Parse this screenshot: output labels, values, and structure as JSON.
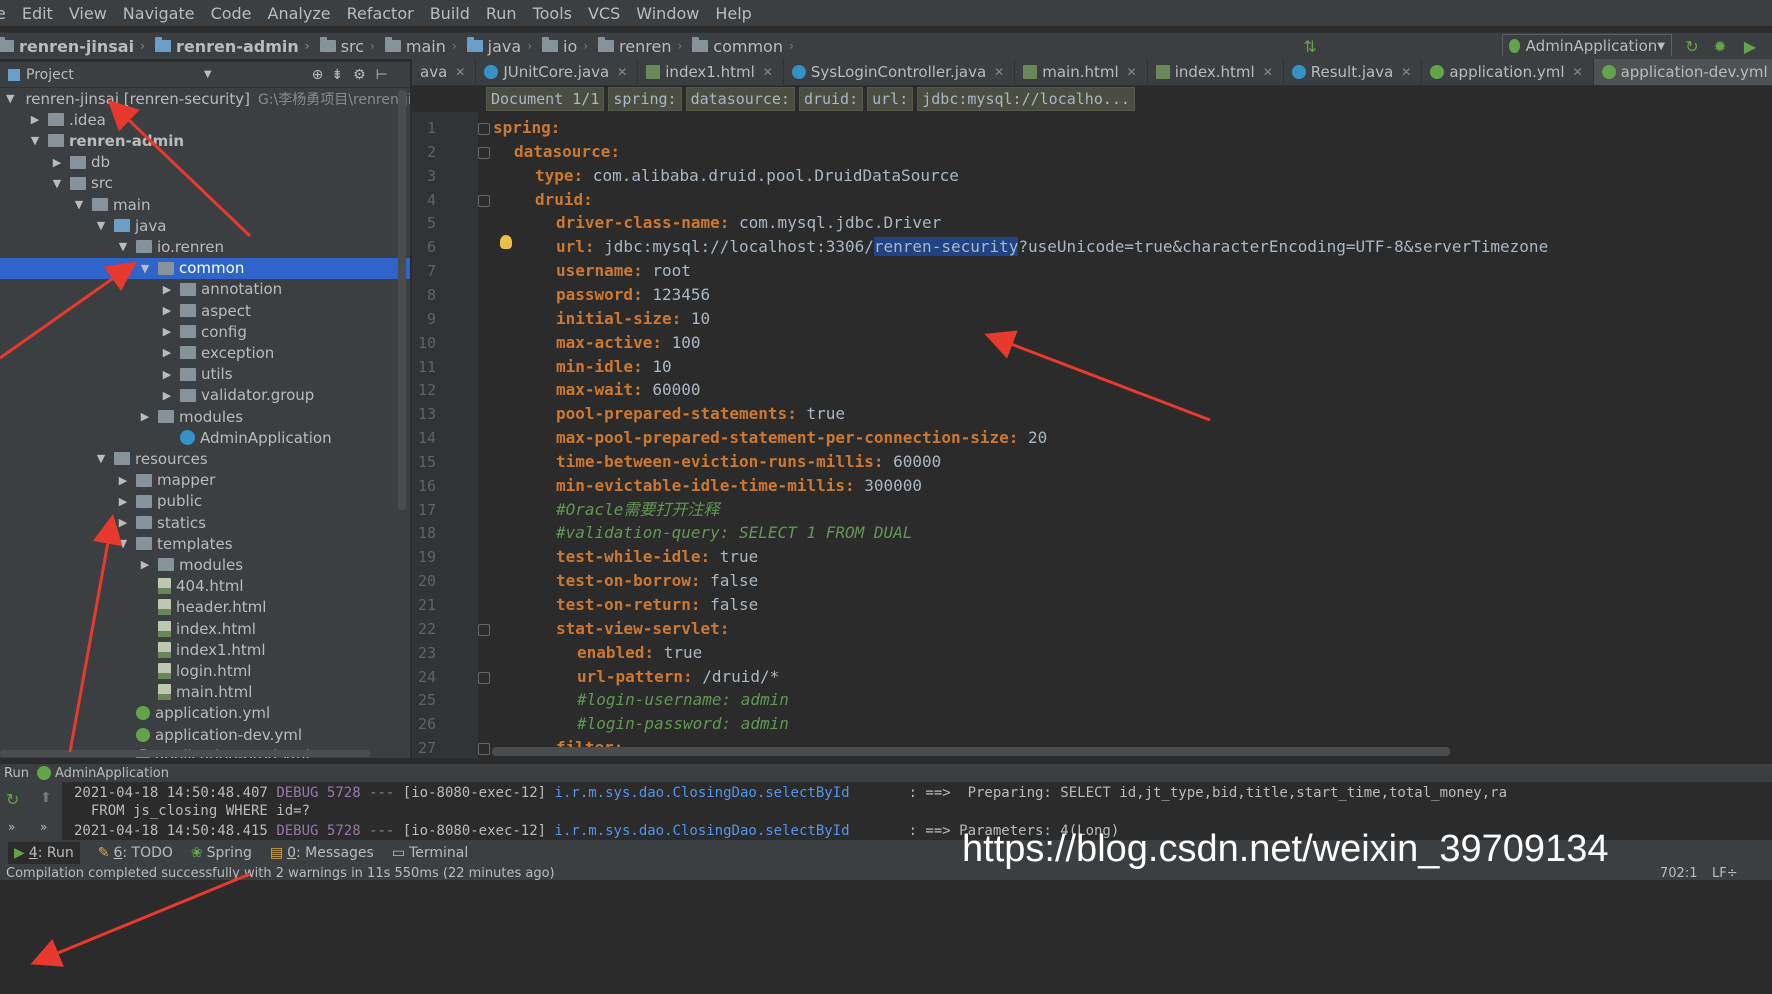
{
  "menu": [
    "e",
    "Edit",
    "View",
    "Navigate",
    "Code",
    "Analyze",
    "Refactor",
    "Build",
    "Run",
    "Tools",
    "VCS",
    "Window",
    "Help"
  ],
  "breadcrumbs": [
    {
      "label": "renren-jinsai",
      "bold": true
    },
    {
      "label": "renren-admin",
      "bold": true
    },
    {
      "label": "src"
    },
    {
      "label": "main"
    },
    {
      "label": "java"
    },
    {
      "label": "io"
    },
    {
      "label": "renren"
    },
    {
      "label": "common"
    }
  ],
  "run_config": "AdminApplication",
  "project_panel": {
    "title": "Project"
  },
  "tree": [
    {
      "label": "renren-jinsai [renren-security]",
      "extra": "G:\\李杨勇项目\\renren-jinsai",
      "depth": 0,
      "arrow": "▼",
      "icon": "folder",
      "bold": false
    },
    {
      "label": ".idea",
      "depth": 1,
      "arrow": "▶",
      "icon": "folder"
    },
    {
      "label": "renren-admin",
      "depth": 1,
      "arrow": "▼",
      "icon": "folder",
      "bold": true
    },
    {
      "label": "db",
      "depth": 2,
      "arrow": "▶",
      "icon": "folder"
    },
    {
      "label": "src",
      "depth": 2,
      "arrow": "▼",
      "icon": "folder"
    },
    {
      "label": "main",
      "depth": 3,
      "arrow": "▼",
      "icon": "folder"
    },
    {
      "label": "java",
      "depth": 4,
      "arrow": "▼",
      "icon": "folder-blue"
    },
    {
      "label": "io.renren",
      "depth": 5,
      "arrow": "▼",
      "icon": "folder"
    },
    {
      "label": "common",
      "depth": 6,
      "arrow": "▼",
      "icon": "folder",
      "selected": true
    },
    {
      "label": "annotation",
      "depth": 7,
      "arrow": "▶",
      "icon": "folder"
    },
    {
      "label": "aspect",
      "depth": 7,
      "arrow": "▶",
      "icon": "folder"
    },
    {
      "label": "config",
      "depth": 7,
      "arrow": "▶",
      "icon": "folder"
    },
    {
      "label": "exception",
      "depth": 7,
      "arrow": "▶",
      "icon": "folder"
    },
    {
      "label": "utils",
      "depth": 7,
      "arrow": "▶",
      "icon": "folder"
    },
    {
      "label": "validator.group",
      "depth": 7,
      "arrow": "▶",
      "icon": "folder"
    },
    {
      "label": "modules",
      "depth": 6,
      "arrow": "▶",
      "icon": "folder"
    },
    {
      "label": "AdminApplication",
      "depth": 7,
      "arrow": "",
      "icon": "class"
    },
    {
      "label": "resources",
      "depth": 4,
      "arrow": "▼",
      "icon": "folder"
    },
    {
      "label": "mapper",
      "depth": 5,
      "arrow": "▶",
      "icon": "folder"
    },
    {
      "label": "public",
      "depth": 5,
      "arrow": "▶",
      "icon": "folder"
    },
    {
      "label": "statics",
      "depth": 5,
      "arrow": "▶",
      "icon": "folder"
    },
    {
      "label": "templates",
      "depth": 5,
      "arrow": "▼",
      "icon": "folder"
    },
    {
      "label": "modules",
      "depth": 6,
      "arrow": "▶",
      "icon": "folder"
    },
    {
      "label": "404.html",
      "depth": 6,
      "arrow": "",
      "icon": "html"
    },
    {
      "label": "header.html",
      "depth": 6,
      "arrow": "",
      "icon": "html"
    },
    {
      "label": "index.html",
      "depth": 6,
      "arrow": "",
      "icon": "html"
    },
    {
      "label": "index1.html",
      "depth": 6,
      "arrow": "",
      "icon": "html"
    },
    {
      "label": "login.html",
      "depth": 6,
      "arrow": "",
      "icon": "html"
    },
    {
      "label": "main.html",
      "depth": 6,
      "arrow": "",
      "icon": "html"
    },
    {
      "label": "application.yml",
      "depth": 5,
      "arrow": "",
      "icon": "yml"
    },
    {
      "label": "application-dev.yml",
      "depth": 5,
      "arrow": "",
      "icon": "yml"
    },
    {
      "label": "application-prod.yml",
      "depth": 5,
      "arrow": "",
      "icon": "yml"
    }
  ],
  "tabs": [
    {
      "label": "ava",
      "icon": "none"
    },
    {
      "label": "JUnitCore.java",
      "icon": "class"
    },
    {
      "label": "index1.html",
      "icon": "html"
    },
    {
      "label": "SysLoginController.java",
      "icon": "class"
    },
    {
      "label": "main.html",
      "icon": "html"
    },
    {
      "label": "index.html",
      "icon": "html"
    },
    {
      "label": "Result.java",
      "icon": "class"
    },
    {
      "label": "application.yml",
      "icon": "yml"
    },
    {
      "label": "application-dev.yml",
      "icon": "yml",
      "active": true
    }
  ],
  "editor_breadcrumb": [
    "Document 1/1",
    "spring:",
    "datasource:",
    "druid:",
    "url:",
    "jdbc:mysql://localho..."
  ],
  "code_lines": [
    {
      "n": "1",
      "indent": 0,
      "key": "spring:",
      "val": ""
    },
    {
      "n": "2",
      "indent": 2,
      "key": "datasource:",
      "val": ""
    },
    {
      "n": "3",
      "indent": 4,
      "key": "type:",
      "val": " com.alibaba.druid.pool.DruidDataSource"
    },
    {
      "n": "4",
      "indent": 4,
      "key": "druid:",
      "val": ""
    },
    {
      "n": "5",
      "indent": 6,
      "key": "driver-class-name:",
      "val": " com.mysql.jdbc.Driver"
    },
    {
      "n": "6",
      "indent": 6,
      "key": "url:",
      "val": " jdbc:mysql://localhost:3306/",
      "hl": "renren-security",
      "tail": "?useUnicode=true&characterEncoding=UTF-8&serverTimezone"
    },
    {
      "n": "7",
      "indent": 6,
      "key": "username:",
      "val": " root"
    },
    {
      "n": "8",
      "indent": 6,
      "key": "password:",
      "val": " 123456"
    },
    {
      "n": "9",
      "indent": 6,
      "key": "initial-size:",
      "val": " 10"
    },
    {
      "n": "10",
      "indent": 6,
      "key": "max-active:",
      "val": " 100"
    },
    {
      "n": "11",
      "indent": 6,
      "key": "min-idle:",
      "val": " 10"
    },
    {
      "n": "12",
      "indent": 6,
      "key": "max-wait:",
      "val": " 60000"
    },
    {
      "n": "13",
      "indent": 6,
      "key": "pool-prepared-statements:",
      "val": " true"
    },
    {
      "n": "14",
      "indent": 6,
      "key": "max-pool-prepared-statement-per-connection-size:",
      "val": " 20"
    },
    {
      "n": "15",
      "indent": 6,
      "key": "time-between-eviction-runs-millis:",
      "val": " 60000"
    },
    {
      "n": "16",
      "indent": 6,
      "key": "min-evictable-idle-time-millis:",
      "val": " 300000"
    },
    {
      "n": "17",
      "indent": 6,
      "comment": "#Oracle需要打开注释"
    },
    {
      "n": "18",
      "indent": 6,
      "comment": "#validation-query: SELECT 1 FROM DUAL"
    },
    {
      "n": "19",
      "indent": 6,
      "key": "test-while-idle:",
      "val": " true"
    },
    {
      "n": "20",
      "indent": 6,
      "key": "test-on-borrow:",
      "val": " false"
    },
    {
      "n": "21",
      "indent": 6,
      "key": "test-on-return:",
      "val": " false"
    },
    {
      "n": "22",
      "indent": 6,
      "key": "stat-view-servlet:",
      "val": ""
    },
    {
      "n": "23",
      "indent": 8,
      "key": "enabled:",
      "val": " true"
    },
    {
      "n": "24",
      "indent": 8,
      "key": "url-pattern:",
      "val": " /druid/*"
    },
    {
      "n": "25",
      "indent": 8,
      "comment": "#login-username: admin"
    },
    {
      "n": "26",
      "indent": 8,
      "comment": "#login-password: admin"
    },
    {
      "n": "27",
      "indent": 6,
      "key": "filter:",
      "val": ""
    }
  ],
  "run_panel": {
    "label": "Run",
    "config": "AdminApplication",
    "log": [
      {
        "ts": "2021-04-18 14:50:48.407",
        "lvl": "DEBUG",
        "pid": "5728",
        "sep": "---",
        "thread": "[io-8080-exec-12]",
        "logger": "i.r.m.sys.dao.ClosingDao.selectById",
        "msg": ": ==>  Preparing: SELECT id,jt_type,bid,title,start_time,total_money,ra"
      },
      {
        "cont": "  FROM js_closing WHERE id=?"
      },
      {
        "ts": "2021-04-18 14:50:48.415",
        "lvl": "DEBUG",
        "pid": "5728",
        "sep": "---",
        "thread": "[io-8080-exec-12]",
        "logger": "i.r.m.sys.dao.ClosingDao.selectById",
        "msg": ": ==> Parameters: 4(Long)"
      }
    ]
  },
  "tool_windows": [
    {
      "key": "4",
      "label": ": Run"
    },
    {
      "key": "6",
      "label": ": TODO"
    },
    {
      "key": "",
      "label": "Spring"
    },
    {
      "key": "0",
      "label": ": Messages"
    },
    {
      "key": "",
      "label": "Terminal"
    }
  ],
  "status": {
    "message": "Compilation completed successfully with 2 warnings in 11s 550ms (22 minutes ago)",
    "pos": "702:1",
    "sep": "LF÷"
  },
  "watermark": "https://blog.csdn.net/weixin_39709134",
  "colors": {
    "keyword": "#cc7832",
    "comment": "#629755",
    "selection": "#2f65ca",
    "annotation_arrow": "#e8392e"
  }
}
